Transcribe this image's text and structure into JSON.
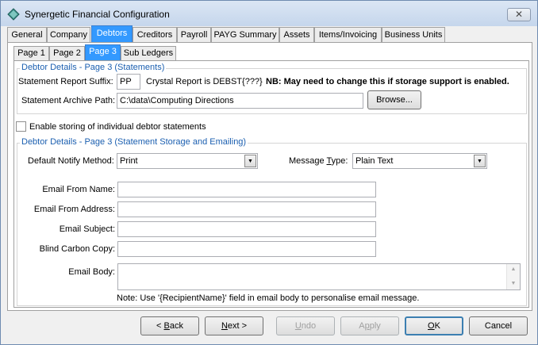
{
  "window": {
    "title": "Synergetic Financial Configuration",
    "icon": "diamond-app-icon",
    "close_glyph": "✕"
  },
  "main_tabs": [
    {
      "label": "General"
    },
    {
      "label": "Company"
    },
    {
      "label": "Debtors",
      "active": true
    },
    {
      "label": "Creditors"
    },
    {
      "label": "Payroll"
    },
    {
      "label": "PAYG Summary"
    },
    {
      "label": "Assets"
    },
    {
      "label": "Items/Invoicing"
    },
    {
      "label": "Business Units"
    }
  ],
  "sub_tabs": [
    {
      "label": "Page 1"
    },
    {
      "label": "Page 2"
    },
    {
      "label": "Page 3",
      "active": true
    },
    {
      "label": "Sub Ledgers"
    }
  ],
  "statements_group": {
    "legend": "Debtor Details  - Page 3 (Statements)",
    "report_suffix_label": "Statement Report Suffix:",
    "report_suffix_value": "PP",
    "crystal_report_text": "Crystal Report is DEBST{???}",
    "nb_text": "NB: May need to change this if storage support is enabled.",
    "archive_path_label": "Statement Archive Path:",
    "archive_path_value": "C:\\data\\Computing Directions",
    "browse_label": "Browse..."
  },
  "enable_storing": {
    "label": "Enable storing of individual debtor statements",
    "checked": false
  },
  "storage_group": {
    "legend": "Debtor Details  - Page 3 (Statement Storage and Emailing)",
    "notify_method_label": "Default Notify Method:",
    "notify_method_value": "Print",
    "message_type_label_pre": "Message ",
    "message_type_label_u": "T",
    "message_type_label_post": "ype:",
    "message_type_value": "Plain Text",
    "email_from_name_label": "Email From Name:",
    "email_from_name_value": "",
    "email_from_address_label": "Email From Address:",
    "email_from_address_value": "",
    "email_subject_label": "Email Subject:",
    "email_subject_value": "",
    "bcc_label": "Blind Carbon Copy:",
    "bcc_value": "",
    "email_body_label": "Email Body:",
    "email_body_value": "",
    "note": "Note:  Use '{RecipientName}' field in email body to personalise email message."
  },
  "footer_buttons": {
    "back_pre": "< ",
    "back_u": "B",
    "back_post": "ack",
    "next_u": "N",
    "next_post": "ext >",
    "undo_u": "U",
    "undo_post": "ndo",
    "apply_pre": "A",
    "apply_u": "p",
    "apply_post": "ply",
    "ok_u": "O",
    "ok_post": "K",
    "cancel_label": "Cancel"
  },
  "colors": {
    "active_tab": "#3399ff",
    "group_legend": "#1b5fb0"
  }
}
